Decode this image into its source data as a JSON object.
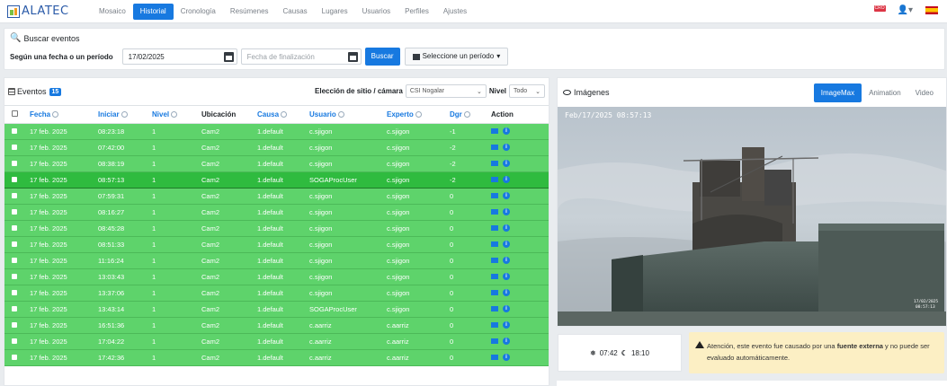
{
  "app": {
    "logo_text": "ALATEC"
  },
  "nav": {
    "items": [
      "Mosaico",
      "Historial",
      "Cronología",
      "Resúmenes",
      "Causas",
      "Lugares",
      "Usuarios",
      "Perfiles",
      "Ajustes"
    ],
    "active": "Historial",
    "notification_badge": "CRO",
    "user_icon": "user-icon",
    "language_flag": "spain-flag"
  },
  "search": {
    "title": "Buscar eventos",
    "label": "Según una fecha o un período",
    "start_date": "17/02/2025",
    "end_placeholder": "Fecha de finalización",
    "search_button": "Buscar",
    "period_button": "Seleccione un período"
  },
  "events": {
    "title": "Eventos",
    "count": "15",
    "site_label": "Elección de sitio / cámara",
    "site_value": "CSI Nogalar",
    "nivel_label": "Nivel",
    "nivel_value": "Todo",
    "columns": [
      "Fecha",
      "Iniciar",
      "Nivel",
      "Ubicación",
      "Causa",
      "Usuario",
      "Experto",
      "Dgr",
      "Action"
    ],
    "rows": [
      {
        "fecha": "17 feb. 2025",
        "iniciar": "08:23:18",
        "nivel": "1",
        "ubicacion": "Cam2",
        "causa": "1.default",
        "usuario": "c.sjigon",
        "experto": "c.sjigon",
        "dgr": "-1"
      },
      {
        "fecha": "17 feb. 2025",
        "iniciar": "07:42:00",
        "nivel": "1",
        "ubicacion": "Cam2",
        "causa": "1.default",
        "usuario": "c.sjigon",
        "experto": "c.sjigon",
        "dgr": "-2"
      },
      {
        "fecha": "17 feb. 2025",
        "iniciar": "08:38:19",
        "nivel": "1",
        "ubicacion": "Cam2",
        "causa": "1.default",
        "usuario": "c.sjigon",
        "experto": "c.sjigon",
        "dgr": "-2"
      },
      {
        "fecha": "17 feb. 2025",
        "iniciar": "08:57:13",
        "nivel": "1",
        "ubicacion": "Cam2",
        "causa": "1.default",
        "usuario": "SOGAProcUser",
        "experto": "c.sjigon",
        "dgr": "-2"
      },
      {
        "fecha": "17 feb. 2025",
        "iniciar": "07:59:31",
        "nivel": "1",
        "ubicacion": "Cam2",
        "causa": "1.default",
        "usuario": "c.sjigon",
        "experto": "c.sjigon",
        "dgr": "0"
      },
      {
        "fecha": "17 feb. 2025",
        "iniciar": "08:16:27",
        "nivel": "1",
        "ubicacion": "Cam2",
        "causa": "1.default",
        "usuario": "c.sjigon",
        "experto": "c.sjigon",
        "dgr": "0"
      },
      {
        "fecha": "17 feb. 2025",
        "iniciar": "08:45:28",
        "nivel": "1",
        "ubicacion": "Cam2",
        "causa": "1.default",
        "usuario": "c.sjigon",
        "experto": "c.sjigon",
        "dgr": "0"
      },
      {
        "fecha": "17 feb. 2025",
        "iniciar": "08:51:33",
        "nivel": "1",
        "ubicacion": "Cam2",
        "causa": "1.default",
        "usuario": "c.sjigon",
        "experto": "c.sjigon",
        "dgr": "0"
      },
      {
        "fecha": "17 feb. 2025",
        "iniciar": "11:16:24",
        "nivel": "1",
        "ubicacion": "Cam2",
        "causa": "1.default",
        "usuario": "c.sjigon",
        "experto": "c.sjigon",
        "dgr": "0"
      },
      {
        "fecha": "17 feb. 2025",
        "iniciar": "13:03:43",
        "nivel": "1",
        "ubicacion": "Cam2",
        "causa": "1.default",
        "usuario": "c.sjigon",
        "experto": "c.sjigon",
        "dgr": "0"
      },
      {
        "fecha": "17 feb. 2025",
        "iniciar": "13:37:06",
        "nivel": "1",
        "ubicacion": "Cam2",
        "causa": "1.default",
        "usuario": "c.sjigon",
        "experto": "c.sjigon",
        "dgr": "0"
      },
      {
        "fecha": "17 feb. 2025",
        "iniciar": "13:43:14",
        "nivel": "1",
        "ubicacion": "Cam2",
        "causa": "1.default",
        "usuario": "SOGAProcUser",
        "experto": "c.sjigon",
        "dgr": "0"
      },
      {
        "fecha": "17 feb. 2025",
        "iniciar": "16:51:36",
        "nivel": "1",
        "ubicacion": "Cam2",
        "causa": "1.default",
        "usuario": "c.aarriz",
        "experto": "c.aarriz",
        "dgr": "0"
      },
      {
        "fecha": "17 feb. 2025",
        "iniciar": "17:04:22",
        "nivel": "1",
        "ubicacion": "Cam2",
        "causa": "1.default",
        "usuario": "c.aarriz",
        "experto": "c.aarriz",
        "dgr": "0"
      },
      {
        "fecha": "17 feb. 2025",
        "iniciar": "17:42:36",
        "nivel": "1",
        "ubicacion": "Cam2",
        "causa": "1.default",
        "usuario": "c.aarriz",
        "experto": "c.aarriz",
        "dgr": "0"
      }
    ],
    "selected_row": 3
  },
  "images": {
    "title": "Imágenes",
    "tabs": [
      "ImageMax",
      "Animation",
      "Video"
    ],
    "active_tab": "ImageMax",
    "timestamp": "Feb/17/2025 08:57:13",
    "corner_stamp_line1": "17/02/2025",
    "corner_stamp_line2": "08:57:13"
  },
  "sun": {
    "sunrise": "07:42",
    "sunset": "18:10"
  },
  "alert": {
    "prefix": "Atención, este evento fue causado por una ",
    "emphasis": "fuente externa",
    "suffix": " y no puede ser evaluado automáticamente."
  },
  "colors": {
    "accent": "#1779e0",
    "row_green": "#5ed36b",
    "row_selected": "#2fbb3f",
    "alert_bg": "#fcefc4"
  }
}
